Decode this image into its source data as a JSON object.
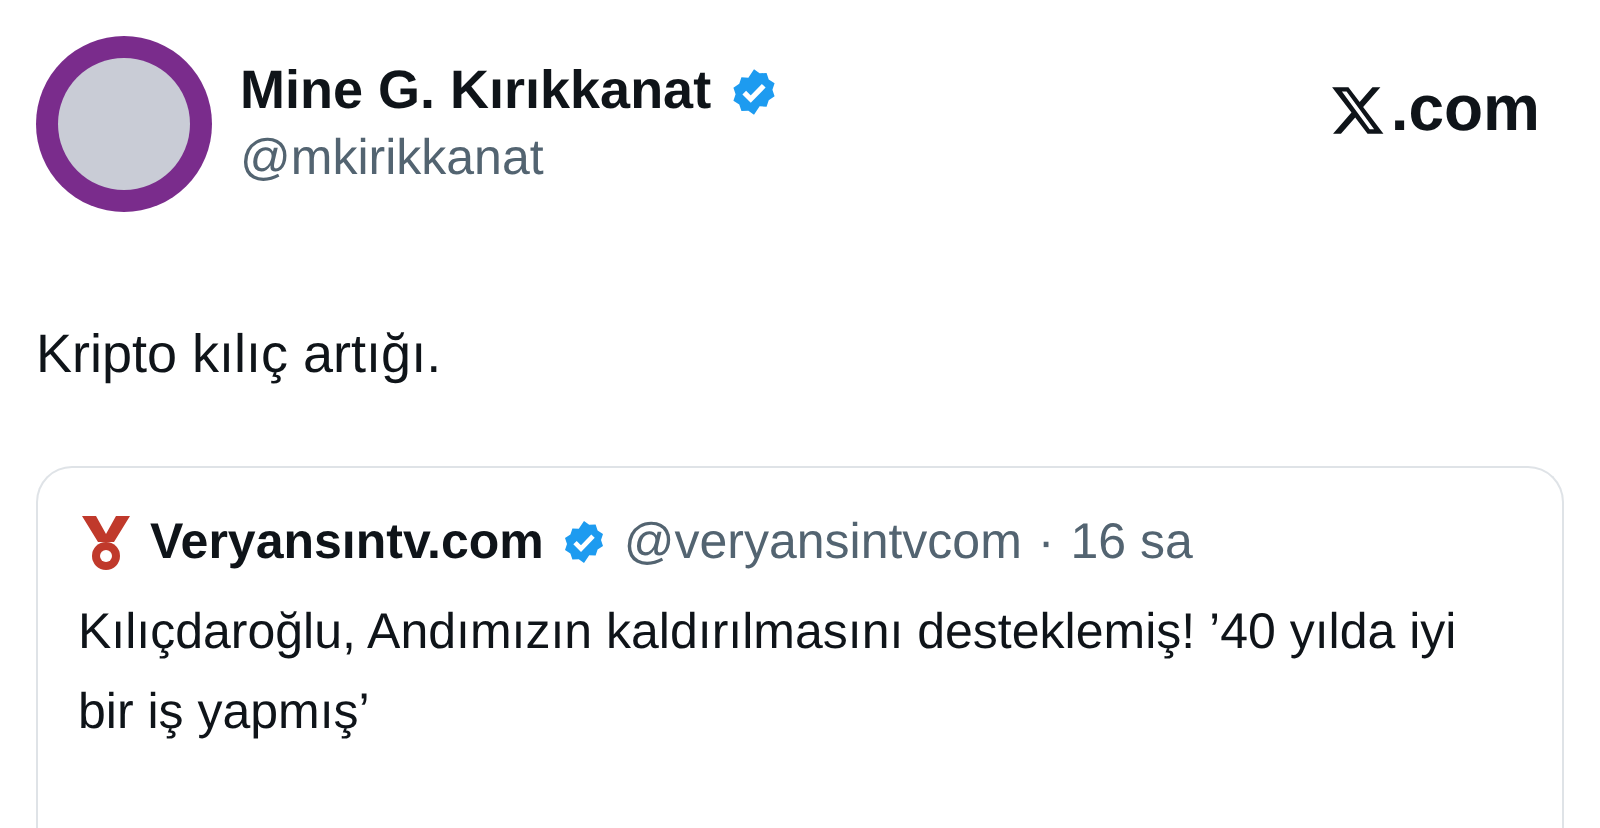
{
  "author": {
    "name": "Mine G. Kırıkkanat",
    "verified": true,
    "handle": "@mkirikkanat"
  },
  "site": {
    "suffix": ".com"
  },
  "text": "Kripto kılıç artığı.",
  "quote": {
    "name": "Veryansıntv.com",
    "verified": true,
    "handle": "@veryansintvcom",
    "separator": "·",
    "time": "16 sa",
    "text": "Kılıçdaroğlu, Andımızın kaldırılmasını desteklemiş! ’40 yılda iyi bir iş yapmış’"
  }
}
